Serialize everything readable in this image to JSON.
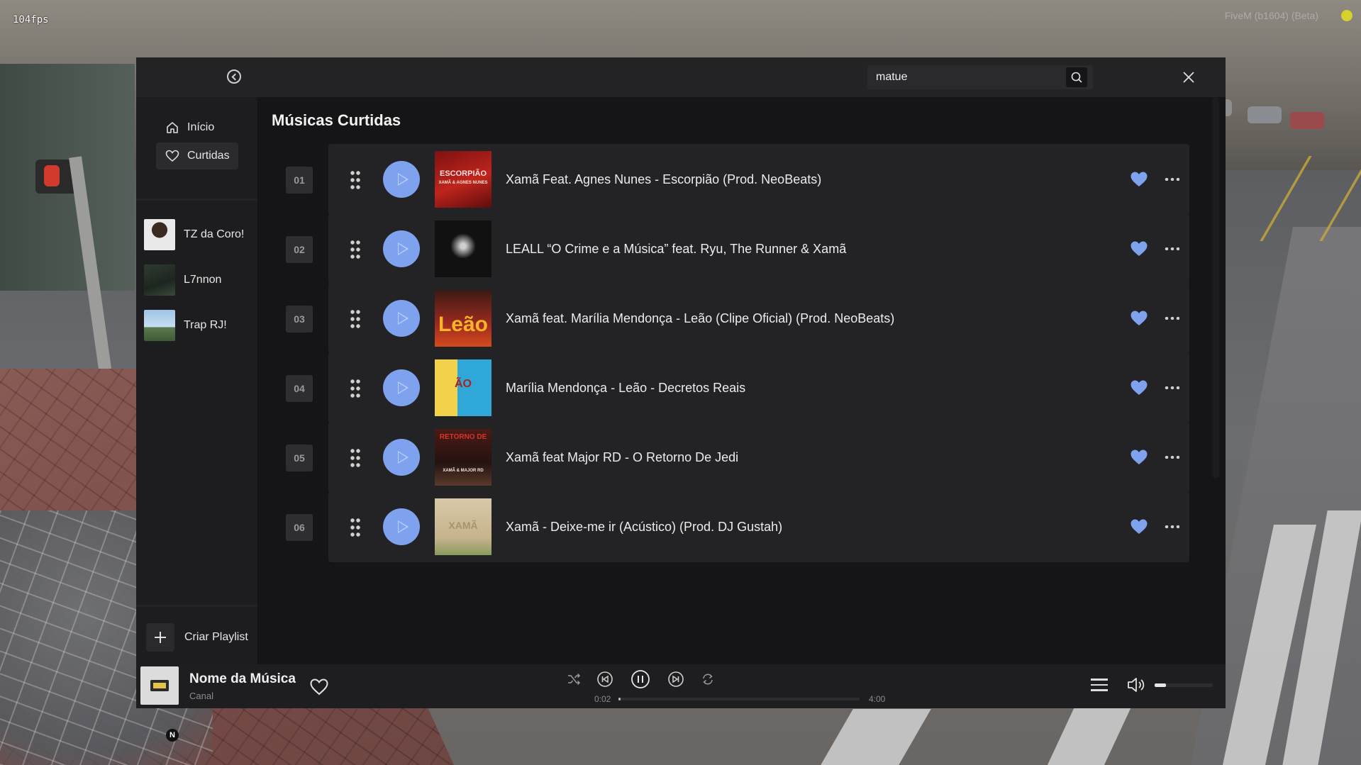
{
  "overlay": {
    "fps": "104fps",
    "build": "FiveM (b1604) (Beta)",
    "minimap_north": "N"
  },
  "sidebar": {
    "nav": [
      {
        "label": "Início",
        "icon": "home-icon"
      },
      {
        "label": "Curtidas",
        "icon": "heart-outline-icon"
      }
    ],
    "playlists": [
      {
        "label": "TZ da Coro!"
      },
      {
        "label": "L7nnon"
      },
      {
        "label": "Trap RJ!"
      }
    ],
    "create_playlist": "Criar Playlist"
  },
  "search": {
    "value": "matue"
  },
  "page_title": "Músicas Curtidas",
  "songs": [
    {
      "num": "01",
      "title": "Xamã Feat. Agnes Nunes - Escorpião (Prod. NeoBeats)",
      "cover_text": "ESCORPIÃO",
      "cover_sub": "XAMÃ & AGNES NUNES"
    },
    {
      "num": "02",
      "title": "LEALL “O Crime e a Música” feat. Ryu, The Runner & Xamã",
      "cover_text": "",
      "cover_sub": ""
    },
    {
      "num": "03",
      "title": "Xamã feat. Marília Mendonça - Leão (Clipe Oficial) (Prod. NeoBeats)",
      "cover_text": "Leão",
      "cover_sub": ""
    },
    {
      "num": "04",
      "title": "Marília Mendonça - Leão - Decretos Reais",
      "cover_text": "ÃO",
      "cover_sub": ""
    },
    {
      "num": "05",
      "title": "Xamã feat Major RD - O Retorno De Jedi",
      "cover_text": "RETORNO DE",
      "cover_sub": "XAMÃ & MAJOR RD"
    },
    {
      "num": "06",
      "title": "Xamã - Deixe-me ir (Acústico) (Prod. DJ Gustah)",
      "cover_text": "XAMÃ",
      "cover_sub": ""
    }
  ],
  "player": {
    "title": "Nome da Música",
    "channel": "Canal",
    "current_time": "0:02",
    "total_time": "4:00",
    "progress": 0.008,
    "volume": 0.2
  },
  "colors": {
    "accent": "#7fa2ee",
    "panel": "#232326",
    "background": "#151517"
  }
}
